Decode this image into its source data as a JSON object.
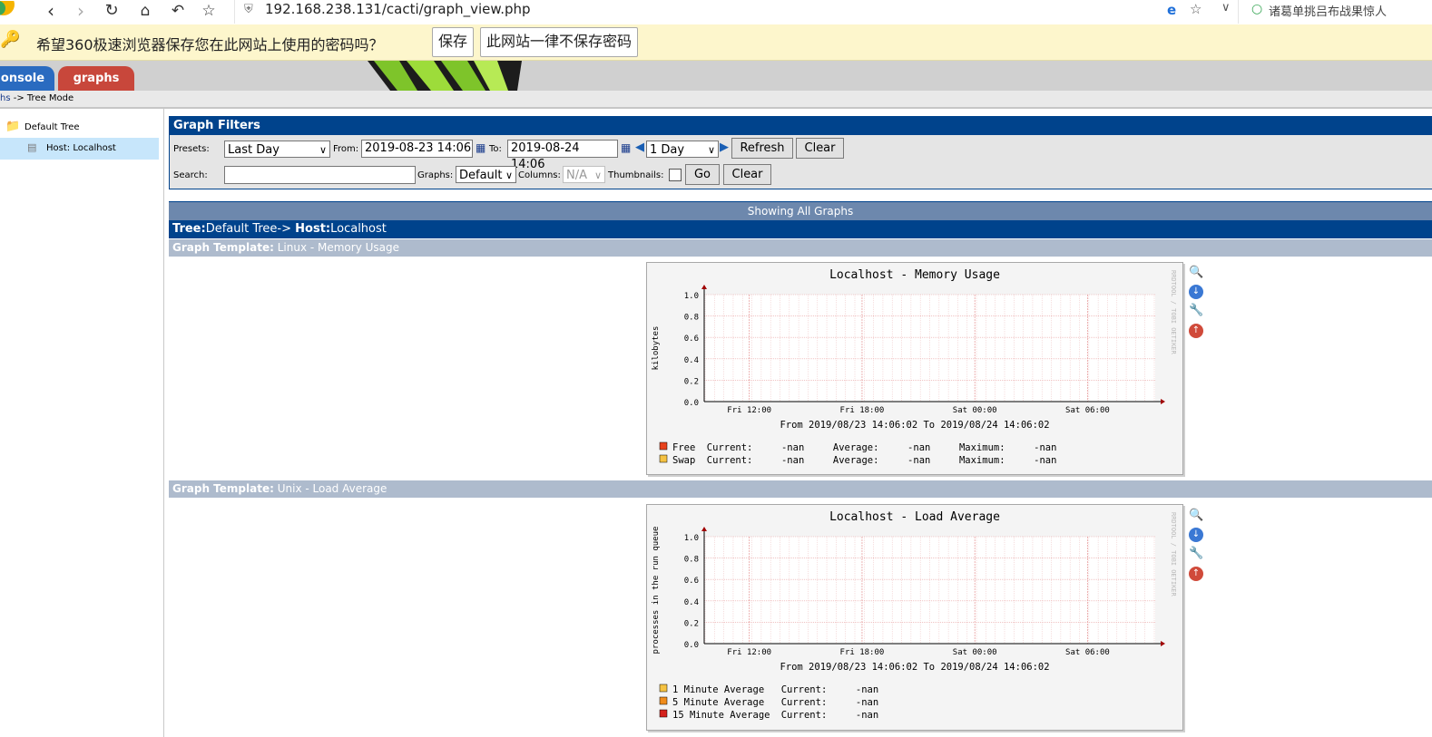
{
  "browser": {
    "url": "192.168.238.131/cacti/graph_view.php",
    "search_text": "诸葛单挑吕布战果惊人",
    "password_prompt": "希望360极速浏览器保存您在此网站上使用的密码吗？",
    "save_label": "保存",
    "never_save_label": "此网站一律不保存密码"
  },
  "header": {
    "tabs": [
      {
        "label": "onsole",
        "color": "#1a5fb4"
      },
      {
        "label": "graphs",
        "color": "#c0392b"
      }
    ],
    "breadcrumb_link": "hs",
    "breadcrumb_rest": " -> Tree Mode"
  },
  "tree": {
    "root": "Default Tree",
    "host": "Host: Localhost"
  },
  "filters": {
    "title": "Graph Filters",
    "presets_label": "Presets:",
    "presets_value": "Last Day",
    "from_label": "From:",
    "from_value": "2019-08-23 14:06",
    "to_label": "To:",
    "to_value": "2019-08-24 14:06",
    "timespan_value": "1 Day",
    "refresh_label": "Refresh",
    "clear_label": "Clear",
    "search_label": "Search:",
    "search_value": "",
    "graphs_label": "Graphs:",
    "graphs_value": "Default",
    "columns_label": "Columns:",
    "columns_value": "N/A",
    "thumbnails_label": "Thumbnails:",
    "go_label": "Go",
    "clear2_label": "Clear"
  },
  "graphs_section": {
    "showing": "Showing All Graphs",
    "tree_label": "Tree:",
    "tree_value": "Default Tree->",
    "host_label": "Host:",
    "host_value": "Localhost"
  },
  "templates": [
    {
      "label": "Graph Template:",
      "name": "Linux - Memory Usage",
      "graph": {
        "title": "Localhost - Memory Usage",
        "ylabel": "kilobytes",
        "watermark": "RRDTOOL / TOBI OETIKER",
        "yticks": [
          "1.0",
          "0.8",
          "0.6",
          "0.4",
          "0.2",
          "0.0"
        ],
        "xticks": [
          "Fri 12:00",
          "Fri 18:00",
          "Sat 00:00",
          "Sat 06:00"
        ],
        "range": "From 2019/08/23 14:06:02 To 2019/08/24 14:06:02",
        "legend": [
          {
            "name": "Free",
            "color": "#e8421c",
            "text": "Current:     -nan     Average:     -nan     Maximum:     -nan"
          },
          {
            "name": "Swap",
            "color": "#f5c242",
            "text": "Current:     -nan     Average:     -nan     Maximum:     -nan"
          }
        ]
      }
    },
    {
      "label": "Graph Template:",
      "name": "Unix - Load Average",
      "graph": {
        "title": "Localhost - Load Average",
        "ylabel": "processes in the run queue",
        "watermark": "RRDTOOL / TOBI OETIKER",
        "yticks": [
          "1.0",
          "0.8",
          "0.6",
          "0.4",
          "0.2",
          "0.0"
        ],
        "xticks": [
          "Fri 12:00",
          "Fri 18:00",
          "Sat 00:00",
          "Sat 06:00"
        ],
        "range": "From 2019/08/23 14:06:02 To 2019/08/24 14:06:02",
        "legend": [
          {
            "name": "1 Minute Average",
            "color": "#f5c242",
            "text": "Current:     -nan"
          },
          {
            "name": "5 Minute Average",
            "color": "#f08c1c",
            "text": "Current:     -nan"
          },
          {
            "name": "15 Minute Average",
            "color": "#d4211c",
            "text": "Current:     -nan"
          }
        ]
      }
    }
  ],
  "icons": [
    "zoom-icon",
    "export-icon",
    "edit-icon",
    "debug-icon"
  ]
}
